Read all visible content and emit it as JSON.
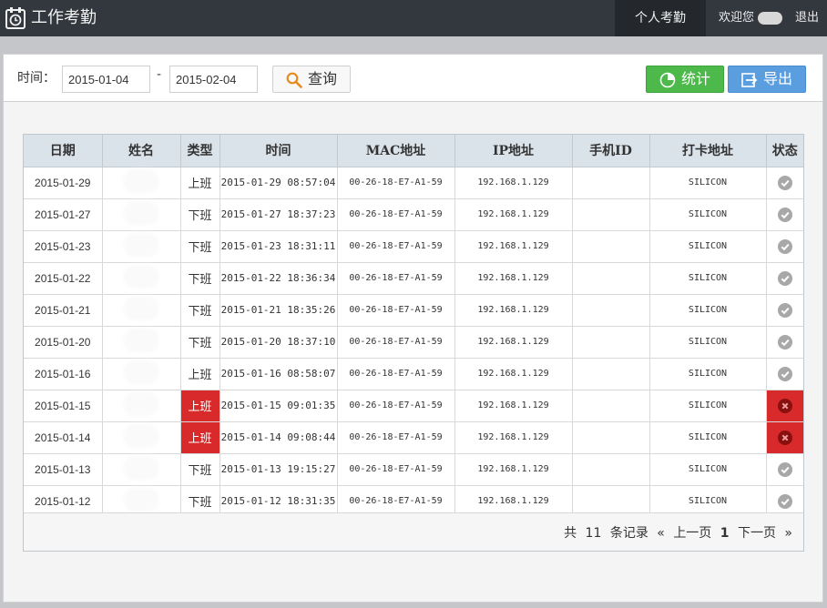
{
  "app": {
    "title": "工作考勤"
  },
  "nav": {
    "active_tab": "个人考勤",
    "welcome": "欢迎您",
    "logout": "退出"
  },
  "filter": {
    "label": "时间：",
    "start_date": "2015-01-04",
    "separator": "-",
    "end_date": "2015-02-04",
    "query_label": "查询",
    "stat_label": "统计",
    "export_label": "导出"
  },
  "table": {
    "columns": [
      "日期",
      "姓名",
      "类型",
      "时间",
      "MAC地址",
      "IP地址",
      "手机ID",
      "打卡地址",
      "状态"
    ],
    "rows": [
      {
        "date": "2015-01-29",
        "type": "上班",
        "time": "2015-01-29 08:57:04",
        "mac": "00-26-18-E7-A1-59",
        "ip": "192.168.1.129",
        "phone_id": "",
        "addr": "SILICON",
        "status": "ok"
      },
      {
        "date": "2015-01-27",
        "type": "下班",
        "time": "2015-01-27 18:37:23",
        "mac": "00-26-18-E7-A1-59",
        "ip": "192.168.1.129",
        "phone_id": "",
        "addr": "SILICON",
        "status": "ok"
      },
      {
        "date": "2015-01-23",
        "type": "下班",
        "time": "2015-01-23 18:31:11",
        "mac": "00-26-18-E7-A1-59",
        "ip": "192.168.1.129",
        "phone_id": "",
        "addr": "SILICON",
        "status": "ok"
      },
      {
        "date": "2015-01-22",
        "type": "下班",
        "time": "2015-01-22 18:36:34",
        "mac": "00-26-18-E7-A1-59",
        "ip": "192.168.1.129",
        "phone_id": "",
        "addr": "SILICON",
        "status": "ok"
      },
      {
        "date": "2015-01-21",
        "type": "下班",
        "time": "2015-01-21 18:35:26",
        "mac": "00-26-18-E7-A1-59",
        "ip": "192.168.1.129",
        "phone_id": "",
        "addr": "SILICON",
        "status": "ok"
      },
      {
        "date": "2015-01-20",
        "type": "下班",
        "time": "2015-01-20 18:37:10",
        "mac": "00-26-18-E7-A1-59",
        "ip": "192.168.1.129",
        "phone_id": "",
        "addr": "SILICON",
        "status": "ok"
      },
      {
        "date": "2015-01-16",
        "type": "上班",
        "time": "2015-01-16 08:58:07",
        "mac": "00-26-18-E7-A1-59",
        "ip": "192.168.1.129",
        "phone_id": "",
        "addr": "SILICON",
        "status": "ok"
      },
      {
        "date": "2015-01-15",
        "type": "上班",
        "time": "2015-01-15 09:01:35",
        "mac": "00-26-18-E7-A1-59",
        "ip": "192.168.1.129",
        "phone_id": "",
        "addr": "SILICON",
        "status": "error"
      },
      {
        "date": "2015-01-14",
        "type": "上班",
        "time": "2015-01-14 09:08:44",
        "mac": "00-26-18-E7-A1-59",
        "ip": "192.168.1.129",
        "phone_id": "",
        "addr": "SILICON",
        "status": "error"
      },
      {
        "date": "2015-01-13",
        "type": "下班",
        "time": "2015-01-13 19:15:27",
        "mac": "00-26-18-E7-A1-59",
        "ip": "192.168.1.129",
        "phone_id": "",
        "addr": "SILICON",
        "status": "ok"
      },
      {
        "date": "2015-01-12",
        "type": "下班",
        "time": "2015-01-12 18:31:35",
        "mac": "00-26-18-E7-A1-59",
        "ip": "192.168.1.129",
        "phone_id": "",
        "addr": "SILICON",
        "status": "ok"
      }
    ]
  },
  "pager": {
    "total_prefix": "共",
    "total": "11",
    "total_suffix": "条记录",
    "prev_arrow": "«",
    "prev": "上一页",
    "current": "1",
    "next": "下一页",
    "next_arrow": "»"
  },
  "colors": {
    "topbar": "#33373e",
    "active_tab": "#24272c",
    "stat_button": "#4cb94a",
    "export_button": "#5b9ee0",
    "error": "#d82a2a",
    "ok_icon": "#a8a8a8"
  },
  "icons": {
    "app": "calendar-clock-icon",
    "query": "search-icon",
    "stat": "pie-chart-icon",
    "export": "export-icon",
    "ok": "check-circle-icon",
    "error": "x-circle-icon"
  }
}
